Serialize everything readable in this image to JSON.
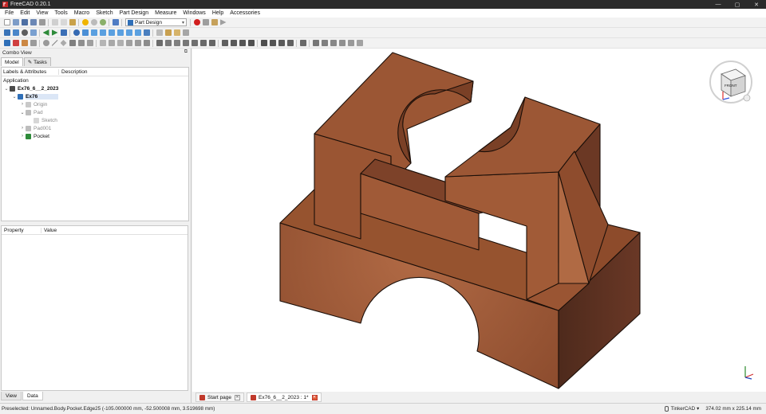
{
  "window": {
    "title": "FreeCAD 0.20.1"
  },
  "menu": [
    "File",
    "Edit",
    "View",
    "Tools",
    "Macro",
    "Sketch",
    "Part Design",
    "Measure",
    "Windows",
    "Help",
    "Accessories"
  ],
  "workbench": {
    "selected": "Part Design"
  },
  "combo_view": {
    "title": "Combo View",
    "tabs": [
      "Model",
      "Tasks"
    ],
    "tree_columns": [
      "Labels & Attributes",
      "Description"
    ],
    "tree": [
      {
        "label": "Application",
        "level": 0
      },
      {
        "label": "Ex76_6__2_2023",
        "level": 1
      },
      {
        "label": "Ex76",
        "level": 2
      },
      {
        "label": "Origin",
        "level": 3
      },
      {
        "label": "Pad",
        "level": 3
      },
      {
        "label": "Sketch",
        "level": 4
      },
      {
        "label": "Pad001",
        "level": 3
      },
      {
        "label": "Pocket",
        "level": 3
      }
    ],
    "property_columns": [
      "Property",
      "Value"
    ],
    "bottom_tabs": [
      "View",
      "Data"
    ]
  },
  "navcube": {
    "face_label": "FRONT"
  },
  "doc_tabs": [
    "Start page",
    "Ex76_6__2_2023 : 1*"
  ],
  "status": {
    "preselected": "Preselected: Unnamed.Body.Pocket.Edge25 (-105.000000 mm, -52.500008 mm, 3.519698 mm)",
    "nav_style": "TinkerCAD",
    "dimensions": "374.02 mm x 225.14 mm"
  },
  "colors": {
    "part": "#8a4a2c",
    "part_light": "#a55d38",
    "part_dark": "#5c3022",
    "accent_record": "#d11f1f"
  }
}
